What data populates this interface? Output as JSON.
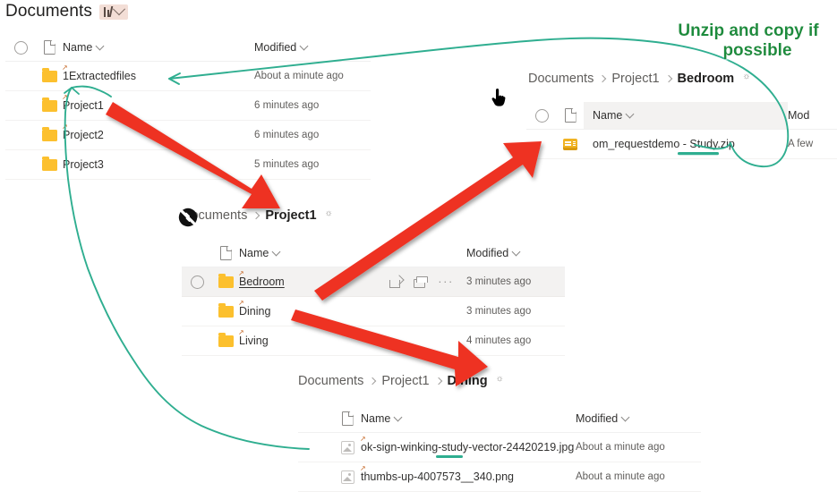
{
  "page": {
    "title": "Documents",
    "title_chip_icon": "columns-dropdown-icon"
  },
  "colors": {
    "annotation_red": "#ee3124",
    "annotation_green_line": "#2fae90",
    "annotation_green_text": "#1f8c3c",
    "folder_yellow": "#fcc02e",
    "selected_row": "#f3f2f1"
  },
  "annotations": {
    "note": "Unzip and copy if\npossible",
    "note_line1": "Unzip and copy if",
    "note_line2": "possible",
    "arrows": [
      {
        "name": "arrow-project1-to-project1-breadcrumb",
        "color": "#ee3124"
      },
      {
        "name": "arrow-bedroom-to-zip-file",
        "color": "#ee3124"
      },
      {
        "name": "arrow-dining-to-dining-breadcrumb",
        "color": "#ee3124"
      }
    ],
    "ink_curves": [
      {
        "name": "curve-dining-images-to-extractedfiles",
        "color": "#2fae90"
      },
      {
        "name": "curve-extractedfiles-to-zip",
        "color": "#2fae90"
      }
    ],
    "underlines": [
      {
        "name": "underline-study-zip",
        "color": "#2fae90"
      },
      {
        "name": "underline-ok-sign-file",
        "color": "#2fae90"
      }
    ]
  },
  "panel_documents": {
    "name": "documents-root-list",
    "headers": {
      "name": "Name",
      "modified": "Modified"
    },
    "rows": [
      {
        "name": "1Extractedfiles",
        "modified": "About a minute ago",
        "icon": "folder-icon",
        "shortcut": true
      },
      {
        "name": "Project1",
        "modified": "6 minutes ago",
        "icon": "folder-icon",
        "shortcut": true
      },
      {
        "name": "Project2",
        "modified": "6 minutes ago",
        "icon": "folder-icon",
        "shortcut": true
      },
      {
        "name": "Project3",
        "modified": "5 minutes ago",
        "icon": "folder-icon",
        "shortcut": false
      }
    ]
  },
  "panel_bedroom": {
    "name": "bedroom-folder-list",
    "breadcrumb": [
      "Documents",
      "Project1",
      "Bedroom"
    ],
    "headers": {
      "name": "Name",
      "modified": "Mod"
    },
    "rows": [
      {
        "name": "om_requestdemo - Study.zip",
        "modified": "A few",
        "icon": "zip-icon"
      }
    ]
  },
  "panel_project1": {
    "name": "project1-folder-list",
    "breadcrumb": [
      "Documents",
      "Project1"
    ],
    "headers": {
      "name": "Name",
      "modified": "Modified"
    },
    "row_actions": {
      "share": "share-icon",
      "copy_link": "copy-link-icon",
      "more": "···"
    },
    "rows": [
      {
        "name": "Bedroom",
        "modified": "3 minutes ago",
        "icon": "folder-icon",
        "selected": true
      },
      {
        "name": "Dining",
        "modified": "3 minutes ago",
        "icon": "folder-icon",
        "selected": false
      },
      {
        "name": "Living",
        "modified": "4 minutes ago",
        "icon": "folder-icon",
        "selected": false
      }
    ]
  },
  "panel_dining": {
    "name": "dining-folder-list",
    "breadcrumb": [
      "Documents",
      "Project1",
      "Dining"
    ],
    "headers": {
      "name": "Name",
      "modified": "Modified"
    },
    "rows": [
      {
        "name": "ok-sign-winking-study-vector-24420219.jpg",
        "modified": "About a minute ago",
        "icon": "image-icon"
      },
      {
        "name": "thumbs-up-4007573__340.png",
        "modified": "About a minute ago",
        "icon": "image-icon"
      }
    ]
  },
  "cursors": [
    {
      "name": "pointing-hand-cursor"
    },
    {
      "name": "not-allowed-cursor"
    }
  ]
}
